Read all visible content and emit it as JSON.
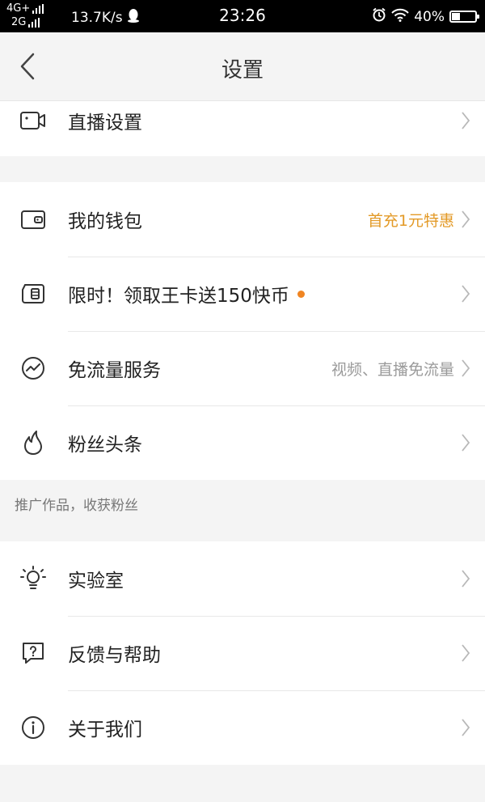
{
  "status_bar": {
    "network_top": "4G+",
    "network_bottom": "2G",
    "speed": "13.7K/s",
    "time": "23:26",
    "battery_percent": "40%",
    "battery_level": 0.4,
    "icons": [
      "qq-icon",
      "alarm-icon",
      "wifi-icon",
      "battery-icon"
    ]
  },
  "header": {
    "title": "设置",
    "back_icon": "chevron-left-icon"
  },
  "groups": [
    {
      "items": [
        {
          "icon": "video-camera-icon",
          "label": "直播设置",
          "value": ""
        }
      ]
    },
    {
      "items": [
        {
          "icon": "wallet-icon",
          "label": "我的钱包",
          "value": "首充1元特惠",
          "value_color": "#e39a27"
        },
        {
          "icon": "sim-card-icon",
          "label": "限时！领取王卡送150快币",
          "value": "",
          "badge_dot": true,
          "badge_color": "#f08522"
        },
        {
          "icon": "data-wave-icon",
          "label": "免流量服务",
          "value": "视频、直播免流量"
        },
        {
          "icon": "flame-icon",
          "label": "粉丝头条",
          "value": ""
        }
      ],
      "footnote": "推广作品，收获粉丝"
    },
    {
      "items": [
        {
          "icon": "lightbulb-icon",
          "label": "实验室",
          "value": ""
        },
        {
          "icon": "help-chat-icon",
          "label": "反馈与帮助",
          "value": ""
        },
        {
          "icon": "info-icon",
          "label": "关于我们",
          "value": ""
        }
      ]
    }
  ]
}
